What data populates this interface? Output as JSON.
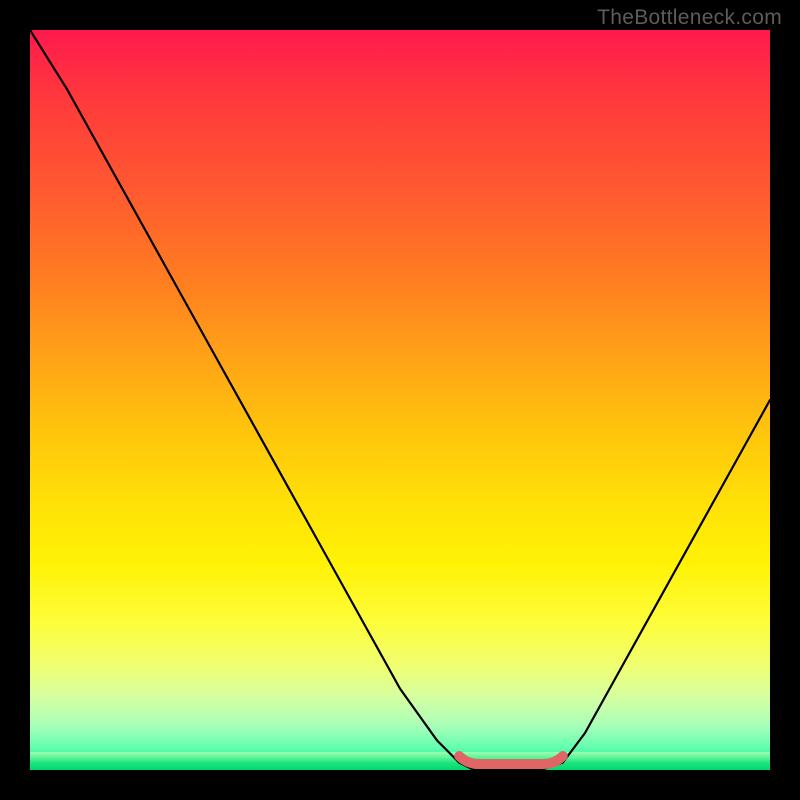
{
  "watermark": "TheBottleneck.com",
  "chart_data": {
    "type": "line",
    "title": "",
    "xlabel": "",
    "ylabel": "",
    "xlim": [
      0,
      1
    ],
    "ylim": [
      0,
      100
    ],
    "grid": false,
    "legend": false,
    "series": [
      {
        "name": "bottleneck-curve",
        "x": [
          0.0,
          0.05,
          0.1,
          0.15,
          0.2,
          0.25,
          0.3,
          0.35,
          0.4,
          0.45,
          0.5,
          0.55,
          0.58,
          0.6,
          0.63,
          0.66,
          0.69,
          0.72,
          0.75,
          0.8,
          0.85,
          0.9,
          0.95,
          1.0
        ],
        "values": [
          100,
          92,
          83,
          74,
          65,
          56,
          47,
          38,
          29,
          20,
          11,
          4,
          1,
          0,
          0,
          0,
          0,
          1,
          5,
          14,
          23,
          32,
          41,
          50
        ]
      }
    ],
    "annotations": [
      {
        "name": "flat-minimum-marker",
        "x_range": [
          0.58,
          0.72
        ],
        "y": 0
      }
    ],
    "background_gradient": {
      "stops": [
        {
          "pos": 0.0,
          "color": "#ff1a4d"
        },
        {
          "pos": 0.5,
          "color": "#ffd000"
        },
        {
          "pos": 0.85,
          "color": "#f5ff60"
        },
        {
          "pos": 1.0,
          "color": "#00d86e"
        }
      ]
    }
  }
}
